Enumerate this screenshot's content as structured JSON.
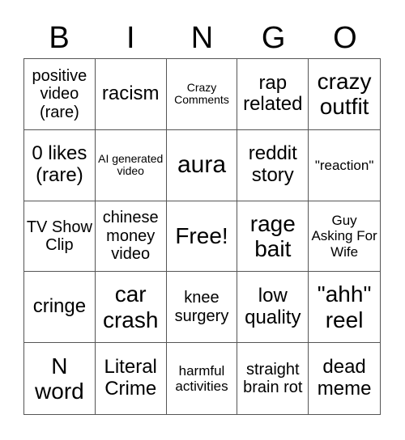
{
  "header": {
    "letters": [
      "B",
      "I",
      "N",
      "G",
      "O"
    ]
  },
  "cells": [
    {
      "text": "positive video (rare)",
      "size": "s-m"
    },
    {
      "text": "racism",
      "size": "s-l"
    },
    {
      "text": "Crazy Comments",
      "size": "s-xs"
    },
    {
      "text": "rap related",
      "size": "s-l"
    },
    {
      "text": "crazy outfit",
      "size": "s-xl"
    },
    {
      "text": "0 likes (rare)",
      "size": "s-l"
    },
    {
      "text": "AI generated video",
      "size": "s-xs"
    },
    {
      "text": "aura",
      "size": "s-xxl"
    },
    {
      "text": "reddit story",
      "size": "s-l"
    },
    {
      "text": "\"reaction\"",
      "size": "s-s"
    },
    {
      "text": "TV Show Clip",
      "size": "s-m"
    },
    {
      "text": "chinese money video",
      "size": "s-m"
    },
    {
      "text": "Free!",
      "size": "s-xl"
    },
    {
      "text": "rage bait",
      "size": "s-xl"
    },
    {
      "text": "Guy Asking For Wife",
      "size": "s-s"
    },
    {
      "text": "cringe",
      "size": "s-l"
    },
    {
      "text": "car crash",
      "size": "s-xl"
    },
    {
      "text": "knee surgery",
      "size": "s-m"
    },
    {
      "text": "low quality",
      "size": "s-l"
    },
    {
      "text": "\"ahh\" reel",
      "size": "s-xl"
    },
    {
      "text": "N word",
      "size": "s-xl"
    },
    {
      "text": "Literal Crime",
      "size": "s-l"
    },
    {
      "text": "harmful activities",
      "size": "s-s"
    },
    {
      "text": "straight brain rot",
      "size": "s-m"
    },
    {
      "text": "dead meme",
      "size": "s-l"
    }
  ]
}
